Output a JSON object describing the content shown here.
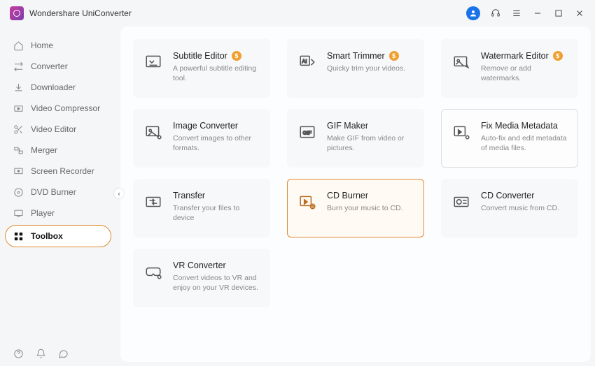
{
  "app": {
    "title": "Wondershare UniConverter"
  },
  "sidebar": {
    "items": [
      {
        "label": "Home"
      },
      {
        "label": "Converter"
      },
      {
        "label": "Downloader"
      },
      {
        "label": "Video Compressor"
      },
      {
        "label": "Video Editor"
      },
      {
        "label": "Merger"
      },
      {
        "label": "Screen Recorder"
      },
      {
        "label": "DVD Burner"
      },
      {
        "label": "Player"
      },
      {
        "label": "Toolbox"
      }
    ]
  },
  "tools": [
    {
      "title": "Subtitle Editor",
      "desc": "A powerful subtitle editing tool.",
      "badge": "$"
    },
    {
      "title": "Smart Trimmer",
      "desc": "Quicky trim your videos.",
      "badge": "$"
    },
    {
      "title": "Watermark Editor",
      "desc": "Remove or add watermarks.",
      "badge": "$"
    },
    {
      "title": "Image Converter",
      "desc": "Convert images to other formats."
    },
    {
      "title": "GIF Maker",
      "desc": "Make GIF from video or pictures."
    },
    {
      "title": "Fix Media Metadata",
      "desc": "Auto-fix and edit metadata of media files."
    },
    {
      "title": "Transfer",
      "desc": "Transfer your files to device"
    },
    {
      "title": "CD Burner",
      "desc": "Burn your music to CD."
    },
    {
      "title": "CD Converter",
      "desc": "Convert music from CD."
    },
    {
      "title": "VR Converter",
      "desc": "Convert videos to VR and enjoy on your VR devices."
    }
  ]
}
